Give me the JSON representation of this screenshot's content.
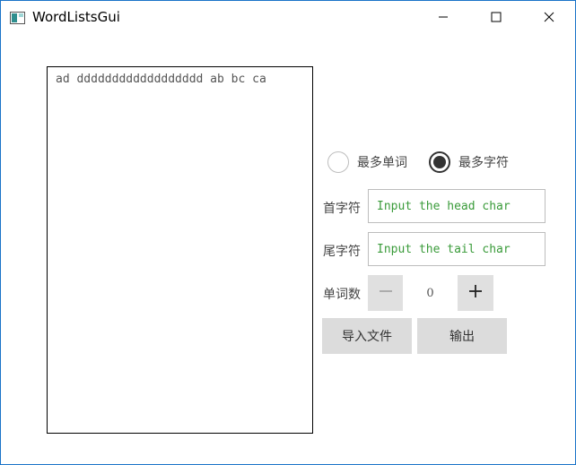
{
  "window": {
    "title": "WordListsGui",
    "icons": {
      "app": "app-window-icon",
      "minimize": "minimize-icon",
      "maximize": "maximize-icon",
      "close": "close-icon"
    }
  },
  "editor": {
    "content": "ad dddddddddddddddddd ab bc ca"
  },
  "mode": {
    "options": [
      {
        "label": "最多单词",
        "checked": false
      },
      {
        "label": "最多字符",
        "checked": true
      }
    ]
  },
  "head_char": {
    "label": "首字符",
    "placeholder": "Input the head char",
    "value": ""
  },
  "tail_char": {
    "label": "尾字符",
    "placeholder": "Input the tail char",
    "value": ""
  },
  "word_count": {
    "label": "单词数",
    "value": "0",
    "icons": {
      "decrement": "minus-icon",
      "increment": "plus-icon"
    }
  },
  "actions": {
    "import_label": "导入文件",
    "output_label": "输出"
  },
  "colors": {
    "window_border": "#1a73c8",
    "placeholder_text": "#3a9b3a",
    "button_bg": "#dcdcdc",
    "stepper_bg": "#e0e0e0"
  }
}
